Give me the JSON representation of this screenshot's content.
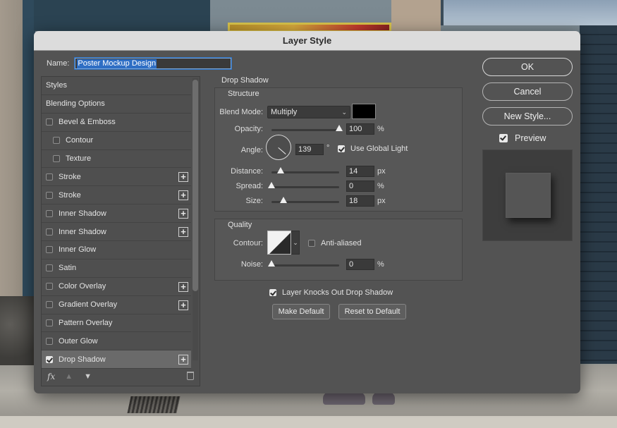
{
  "dialog": {
    "title": "Layer Style"
  },
  "name": {
    "label": "Name:",
    "value": "Poster Mockup Design"
  },
  "styles": {
    "items": [
      {
        "label": "Styles",
        "type": "header",
        "checkbox": false,
        "checked": false,
        "plus": false,
        "indent": false,
        "selected": false
      },
      {
        "label": "Blending Options",
        "type": "header",
        "checkbox": false,
        "checked": false,
        "plus": false,
        "indent": false,
        "selected": false
      },
      {
        "label": "Bevel & Emboss",
        "checkbox": true,
        "checked": false,
        "plus": false,
        "indent": false,
        "selected": false
      },
      {
        "label": "Contour",
        "checkbox": true,
        "checked": false,
        "plus": false,
        "indent": true,
        "selected": false
      },
      {
        "label": "Texture",
        "checkbox": true,
        "checked": false,
        "plus": false,
        "indent": true,
        "selected": false
      },
      {
        "label": "Stroke",
        "checkbox": true,
        "checked": false,
        "plus": true,
        "indent": false,
        "selected": false
      },
      {
        "label": "Stroke",
        "checkbox": true,
        "checked": false,
        "plus": true,
        "indent": false,
        "selected": false
      },
      {
        "label": "Inner Shadow",
        "checkbox": true,
        "checked": false,
        "plus": true,
        "indent": false,
        "selected": false
      },
      {
        "label": "Inner Shadow",
        "checkbox": true,
        "checked": false,
        "plus": true,
        "indent": false,
        "selected": false
      },
      {
        "label": "Inner Glow",
        "checkbox": true,
        "checked": false,
        "plus": false,
        "indent": false,
        "selected": false
      },
      {
        "label": "Satin",
        "checkbox": true,
        "checked": false,
        "plus": false,
        "indent": false,
        "selected": false
      },
      {
        "label": "Color Overlay",
        "checkbox": true,
        "checked": false,
        "plus": true,
        "indent": false,
        "selected": false
      },
      {
        "label": "Gradient Overlay",
        "checkbox": true,
        "checked": false,
        "plus": true,
        "indent": false,
        "selected": false
      },
      {
        "label": "Pattern Overlay",
        "checkbox": true,
        "checked": false,
        "plus": false,
        "indent": false,
        "selected": false
      },
      {
        "label": "Outer Glow",
        "checkbox": true,
        "checked": false,
        "plus": false,
        "indent": false,
        "selected": false
      },
      {
        "label": "Drop Shadow",
        "checkbox": true,
        "checked": true,
        "plus": true,
        "indent": false,
        "selected": true
      }
    ],
    "footer": {
      "fx_label": "fx"
    }
  },
  "drop_shadow": {
    "title": "Drop Shadow",
    "structure": {
      "title": "Structure",
      "blend_mode_label": "Blend Mode:",
      "blend_mode": "Multiply",
      "shadow_color": "#000000",
      "opacity_label": "Opacity:",
      "opacity": "100",
      "opacity_unit": "%",
      "angle_label": "Angle:",
      "angle": "139",
      "angle_unit": "°",
      "use_global_light_label": "Use Global Light",
      "use_global_light": true,
      "distance_label": "Distance:",
      "distance": "14",
      "distance_unit": "px",
      "spread_label": "Spread:",
      "spread": "0",
      "spread_unit": "%",
      "size_label": "Size:",
      "size": "18",
      "size_unit": "px"
    },
    "quality": {
      "title": "Quality",
      "contour_label": "Contour:",
      "anti_aliased_label": "Anti-aliased",
      "anti_aliased": false,
      "noise_label": "Noise:",
      "noise": "0",
      "noise_unit": "%"
    },
    "knockout_label": "Layer Knocks Out Drop Shadow",
    "knockout": true,
    "make_default_label": "Make Default",
    "reset_default_label": "Reset to Default"
  },
  "buttons": {
    "ok": "OK",
    "cancel": "Cancel",
    "new_style": "New Style...",
    "preview_label": "Preview",
    "preview_checked": true
  }
}
